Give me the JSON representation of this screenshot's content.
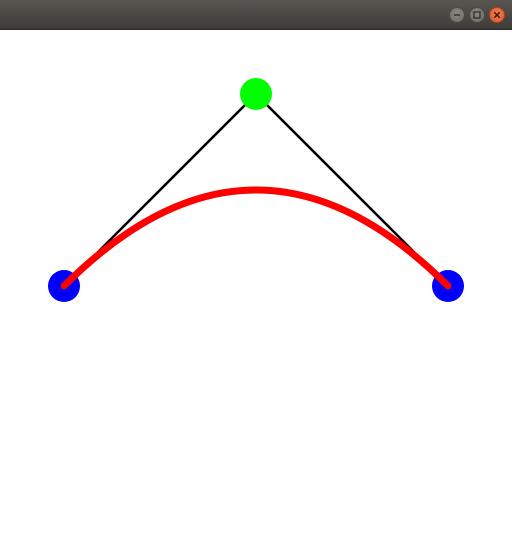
{
  "window": {
    "title": "",
    "controls": {
      "minimize_icon": "minimize-icon",
      "maximize_icon": "maximize-icon",
      "close_icon": "close-icon"
    }
  },
  "scene": {
    "colors": {
      "start_point": "#0000ff",
      "end_point": "#0000ff",
      "control_point": "#00ff00",
      "control_polygon": "#000000",
      "curve": "#ff0000",
      "close_button": "#e95420",
      "titlebar": "#4a4945"
    }
  }
}
